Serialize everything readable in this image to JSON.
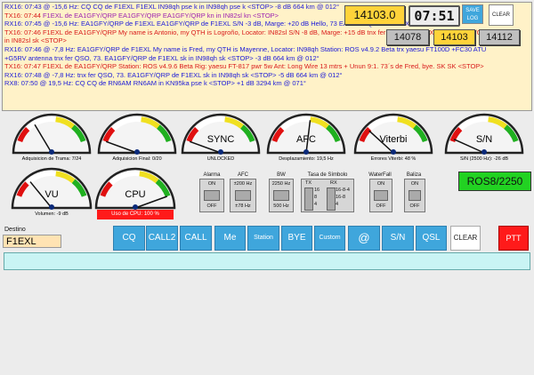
{
  "log": [
    {
      "segs": [
        {
          "t": "RX16: 07:43 @ -15,6 Hz: ",
          "c": "blue"
        },
        {
          "t": "CQ  CQ  de  F1EXL  F1EXL   IN98qh  pse k  in IN98qh pse k  <STOP> -8 dB  664 km @ 012°",
          "c": "blue"
        }
      ]
    },
    {
      "segs": [
        {
          "t": "TX16: 07:44 ",
          "c": "red"
        },
        {
          "t": "F1EXL de EA1GFY/QRP EA1GFY/QRP EA1GFY/QRP kn in IN82sl kn  <STOP>",
          "c": "purple"
        }
      ]
    },
    {
      "segs": [
        {
          "t": "RX16: 07:45 @ -15,6 Hz: EA1GFY/QRP de F1EXL EA1GFY/QRP de F1EXL S/N -3 dB, Marge: +20 dB Hello, 73 EA1GFY/QRP de F1EXL",
          "c": "blue"
        }
      ]
    },
    {
      "segs": [
        {
          "t": "TX16: 07:46 F1EXL de EA1GFY/QRP My name is Antonio, my QTH is Logroño, Locator:  IN82sl S/N -8 dB, Marge: +15 dB tnx fer QSO, 73. F1EXL de EA1GFY/QRP sk",
          "c": "red"
        }
      ]
    },
    {
      "segs": [
        {
          "t": "in IN82sl sk  <STOP>",
          "c": "red"
        }
      ]
    },
    {
      "segs": [
        {
          "t": "RX16: 07:46 @ -7,8 Hz: EA1GFY/QRP de F1EXL My name is Fred, my QTH is Mayenne, Locator:   IN98qh Station: ROS v4.9.2 Beta trx yaesu FT100D +FC30 ATU",
          "c": "blue"
        }
      ]
    },
    {
      "segs": [
        {
          "t": "+G5RV antenna tnx fer QSO, 73. EA1GFY/QRP de F1EXL sk in IN98qh sk  <STOP> -3 dB  664 km @ 012°",
          "c": "blue"
        }
      ]
    },
    {
      "segs": [
        {
          "t": "TX16: 07:47 F1EXL de EA1GFY/QRP Station: ROS v4.9.6 Beta Rig: yaesu FT-817 pwr 5w Ant: Long Wire 13 mtrs + Unun 9:1. 73´s de Fred, bye. SK SK <STOP>",
          "c": "red"
        }
      ]
    },
    {
      "segs": [
        {
          "t": "RX16: 07:48 @ -7,8 Hz: tnx fer QSO, 73. EA1GFY/QRP de F1EXL sk in IN98qh sk  <STOP> -5 dB  664 km @ 012°",
          "c": "blue"
        }
      ]
    },
    {
      "segs": [
        {
          "t": "RX8: 07:50 @ 19,5 Hz: CQ CQ  de  RN6AM  RN6AM in KN95ka pse k  <STOP> +1 dB  3294 km @ 071°",
          "c": "blue"
        }
      ]
    }
  ],
  "header": {
    "freq_main": "14103.0",
    "clock": "07:51",
    "save_log_label": "SAVE\nLOG",
    "clear_label": "CLEAR",
    "freq_left": "14078",
    "freq_center": "14103",
    "freq_right": "14112"
  },
  "gauges": [
    {
      "id": "trama",
      "label": "",
      "caption": "Adquisicion de Trama: 7/24",
      "value": 0.28
    },
    {
      "id": "final",
      "label": "",
      "caption": "Adquisicion Final: 0/20",
      "value": 0.0
    },
    {
      "id": "sync",
      "label": "SYNC",
      "caption": "UNLOCKED",
      "value": 0.0
    },
    {
      "id": "afc",
      "label": "AFC",
      "caption": "Desplazamiento: 19,5 Hz",
      "value": 0.55
    },
    {
      "id": "viterbi",
      "label": "Viterbi",
      "caption": "Errores Viterbi: 48 %",
      "value": 0.16
    },
    {
      "id": "sn",
      "label": "S/N",
      "caption": "S/N (2500 Hz): -26 dB",
      "value": 0.03
    },
    {
      "id": "vu",
      "label": "VU",
      "caption": "Volumen: -9 dB",
      "value": 0.22
    },
    {
      "id": "cpu",
      "label": "CPU",
      "caption": "",
      "value": 1.0
    }
  ],
  "cpu_badge": "Uso de CPU: 100 %",
  "controls": {
    "alarma": {
      "title": "Alarma",
      "on": "ON",
      "off": "OFF"
    },
    "afc": {
      "title": "AFC",
      "top": "±200 Hz",
      "bottom": "±78 Hz"
    },
    "bw": {
      "title": "BW",
      "top": "2250 Hz",
      "bottom": "500 Hz"
    },
    "tasa": {
      "title": "Tasa de Símbolo",
      "tx": "TX",
      "rx": "RX",
      "tx_vals": [
        "16",
        "8",
        "4"
      ],
      "rx_vals": [
        "16-8-4",
        "16-8",
        "4"
      ]
    },
    "waterfall": {
      "title": "WaterFall",
      "on": "ON",
      "off": "OFF"
    },
    "baliza": {
      "title": "Baliza",
      "on": "ON",
      "off": "OFF"
    }
  },
  "mode_display": "ROS8/2250",
  "destino": {
    "label": "Destino",
    "value": "F1EXL"
  },
  "buttons": {
    "cq": "CQ",
    "call2": "CALL2",
    "call": "CALL",
    "me": "Me",
    "station": "Station",
    "bye": "BYE",
    "custom": "Custom",
    "at": "@",
    "sn": "S/N",
    "qsl": "QSL",
    "clear": "CLEAR",
    "ptt": "PTT"
  },
  "colors": {
    "log_bg": "#fff2c8",
    "button_blue": "#3fa6dc",
    "ptt_red": "#ff1a1a",
    "mode_green": "#22d222",
    "tx_input_bg": "#c9f4f4"
  }
}
